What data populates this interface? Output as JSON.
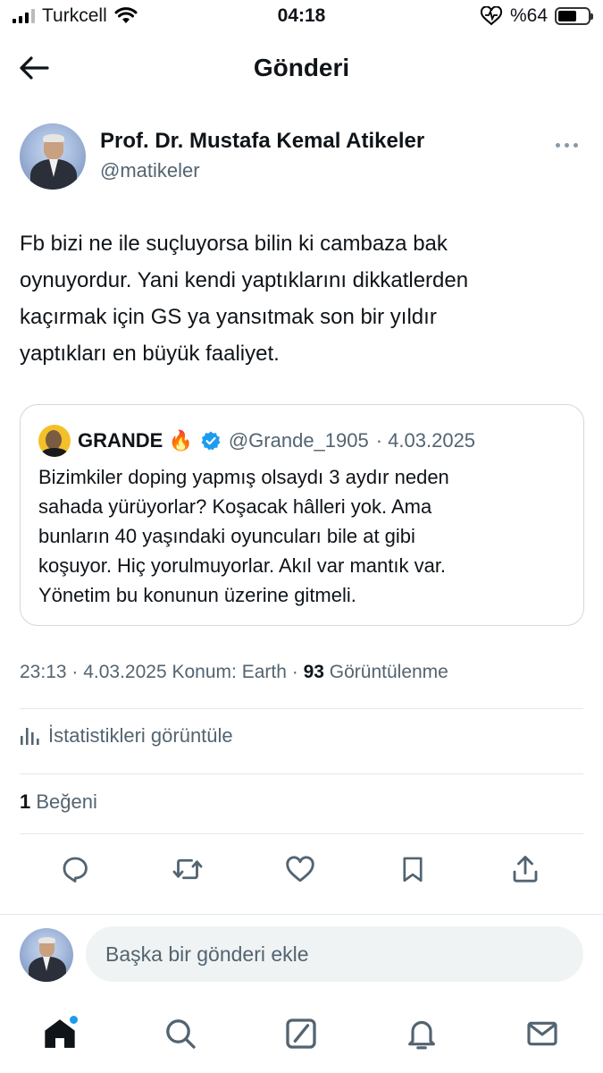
{
  "status_bar": {
    "carrier": "Turkcell",
    "time": "04:18",
    "battery_percent": "%64",
    "battery_level": 0.64
  },
  "header": {
    "title": "Gönderi",
    "back_icon": "arrow-left-icon"
  },
  "post": {
    "author_name": "Prof. Dr. Mustafa Kemal Atikeler",
    "author_handle": "@matikeler",
    "text": "Fb bizi ne ile suçluyorsa bilin ki cambaza bak\noynuyordur. Yani kendi yaptıklarını dikkatlerden\nkaçırmak için GS ya yansıtmak son bir yıldır\nyaptıkları en büyük faaliyet.",
    "quote": {
      "name": "GRANDE 🔥",
      "handle": "@Grande_1905",
      "date": "· 4.03.2025",
      "text": "Bizimkiler doping yapmış olsaydı 3 aydır neden\nsahada yürüyorlar? Koşacak hâlleri yok. Ama\nbunların 40 yaşındaki oyuncuları bile at gibi\nkoşuyor. Hiç yorulmuyorlar. Akıl var mantık var.\nYönetim bu konunun üzerine gitmeli."
    },
    "meta": {
      "time_date": "23:13 · 4.03.2025",
      "location": "Konum: Earth",
      "separator": "·",
      "views_count": "93",
      "views_label": "Görüntülenme"
    },
    "stats_link": "İstatistikleri görüntüle",
    "likes": {
      "count": "1",
      "label": "Beğeni"
    }
  },
  "reply": {
    "placeholder": "Başka bir gönderi ekle"
  },
  "colors": {
    "accent": "#1d9bf0",
    "text": "#0f1419",
    "secondary": "#536471",
    "border": "#cfd9de"
  }
}
